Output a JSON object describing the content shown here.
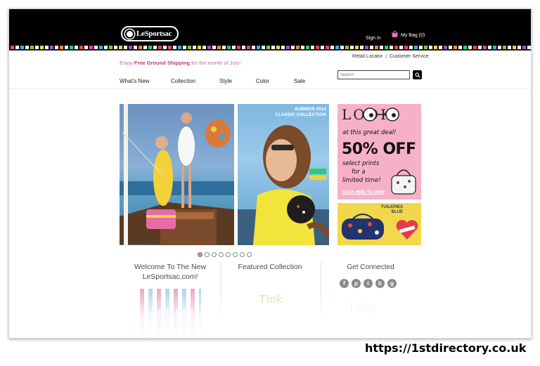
{
  "header": {
    "logo_text": "LeSportsac",
    "sign_in": "Sign in",
    "bag_label": "My Bag (0)"
  },
  "stripe_colors": [
    "#e8438f",
    "#ffffff",
    "#39b3e6",
    "#ffffff",
    "#8dc63f",
    "#ffffff",
    "#f4d03f",
    "#ffffff",
    "#9b59b6",
    "#ffffff",
    "#ff8a3c",
    "#ffffff",
    "#2ecc71",
    "#ffffff",
    "#e74c3c",
    "#ffffff"
  ],
  "utility": {
    "retail_locator": "Retail Locator",
    "separator": "|",
    "customer_service": "Customer Service"
  },
  "promo": {
    "prefix": "Enjoy ",
    "highlight": "Free Ground Shipping",
    "suffix": " for the month of July!"
  },
  "search": {
    "placeholder": "Search"
  },
  "nav": {
    "items": [
      "What's New",
      "Collection",
      "Style",
      "Color",
      "Sale"
    ]
  },
  "hero": {
    "caption_line1": "SUMMER 2014",
    "caption_line2": "CLASSIC COLLECTION"
  },
  "promo_tile": {
    "look": "LOOK",
    "line1": "at this great deal!",
    "big": "50% OFF",
    "line2": "select prints",
    "line3": "for a",
    "line4": "limited time!",
    "cta": "CLICK HERE TO SHOP"
  },
  "promo_tile2": {
    "title_line1": "TUILERIES",
    "title_line2": "BLUE"
  },
  "carousel": {
    "count": 8,
    "active": 0
  },
  "columns": {
    "welcome_line1": "Welcome To The New",
    "welcome_line2": "LeSportsac.com!",
    "featured": "Featured Collection",
    "connect": "Get Connected",
    "signup": "SIGN UP!",
    "tinker": "Tink",
    "connect_logo": "LeSp"
  },
  "social": [
    "f",
    "p",
    "t",
    "b",
    "g"
  ],
  "watermark": "https://1stdirectory.co.uk"
}
